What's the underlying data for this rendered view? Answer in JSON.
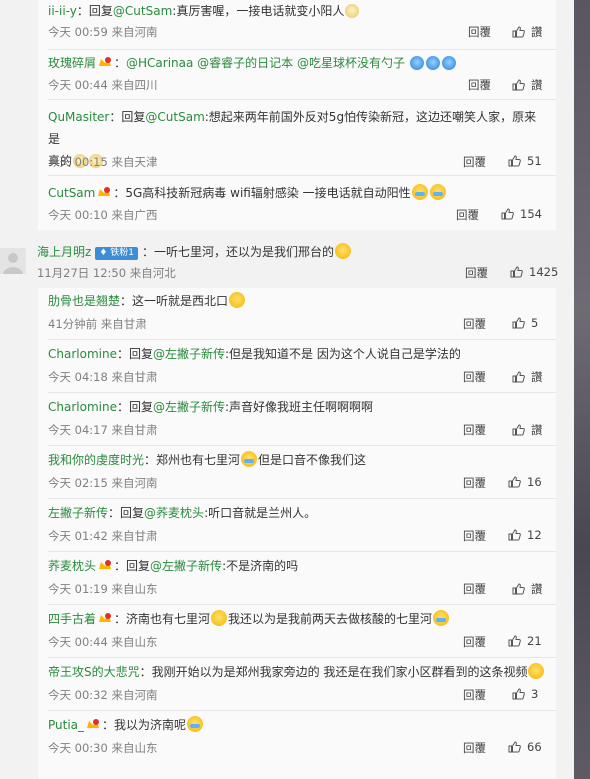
{
  "actions": {
    "reply_label": "回覆",
    "like_label": "讚"
  },
  "thread_top": [
    {
      "user": "ii-ii-y",
      "sep": "：",
      "prefix": "回复",
      "mention": "@CutSam",
      "text": ":真厉害喔，一接电话就变小阳人",
      "time": "今天 00:59 来自河南",
      "likes": "讚",
      "emoji": [
        "cat"
      ]
    },
    {
      "user": "玫瑰碎屑",
      "sep": "：",
      "prefix": "",
      "mention": "@HCarinaa @睿睿子的日记本 @吃星球杯没有勺子",
      "text": "",
      "time": "今天 00:44 来自四川",
      "likes": "讚",
      "vip": true,
      "emoji": [
        "blue",
        "blue",
        "blue"
      ]
    },
    {
      "user": "QuMasiter",
      "sep": "：",
      "prefix": "回复",
      "mention": "@CutSam",
      "text": ":想起来两年前国外反对5g怕传染新冠，这边还嘲笑人家，原来是",
      "text2": "真的",
      "time": "今天 00:15 来自天津",
      "likes": "51",
      "emoji": [
        "cat",
        "cat"
      ]
    },
    {
      "user": "CutSam",
      "sep": "：",
      "prefix": "",
      "mention": "",
      "text": "5G高科技新冠病毒 wifi辐射感染 一接电话就自动阳性",
      "time": "今天 00:10 来自广西",
      "likes": "154",
      "vip": true,
      "emoji": [
        "cry",
        "cry"
      ]
    }
  ],
  "main": {
    "user": "海上月明z",
    "badge": "铁粉1",
    "sep": "：",
    "text": "一听七里河，还以为是我们邢台的",
    "time": "11月27日 12:50 来自河北",
    "likes": "1425"
  },
  "replies": [
    {
      "user": "肋骨也是翘楚",
      "sep": "：",
      "prefix": "",
      "mention": "",
      "text": "这一听就是西北口",
      "time": "41分钟前 来自甘肃",
      "likes": "5",
      "emoji": [
        "plain"
      ]
    },
    {
      "user": "Charlomine",
      "sep": "：",
      "prefix": "回复",
      "mention": "@左撇子新传",
      "text": ":但是我知道不是 因为这个人说自己是学法的",
      "time": "今天 04:18 来自甘肃",
      "likes": "讚"
    },
    {
      "user": "Charlomine",
      "sep": "：",
      "prefix": "回复",
      "mention": "@左撇子新传",
      "text": ":声音好像我班主任啊啊啊啊",
      "time": "今天 04:17 来自甘肃",
      "likes": "讚"
    },
    {
      "user": "我和你的虔度时光",
      "sep": "：",
      "prefix": "",
      "mention": "",
      "text": "郑州也有七里河",
      "text_b": "但是口音不像我们这",
      "time": "今天 02:15 来自河南",
      "likes": "16",
      "emoji": [
        "cry"
      ]
    },
    {
      "user": "左撇子新传",
      "sep": "：",
      "prefix": "回复",
      "mention": "@荞麦枕头",
      "text": ":听口音就是兰州人。",
      "time": "今天 01:42 来自甘肃",
      "likes": "12"
    },
    {
      "user": "荞麦枕头",
      "sep": "：",
      "prefix": "回复",
      "mention": "@左撇子新传",
      "text": ":不是济南的吗",
      "time": "今天 01:19 来自山东",
      "likes": "讚",
      "vip": true
    },
    {
      "user": "四手古着",
      "sep": "：",
      "prefix": "",
      "mention": "",
      "text": "济南也有七里河",
      "text_b": "我还以为是我前两天去做核酸的七里河",
      "time": "今天 00:44 来自山东",
      "likes": "21",
      "vip": true,
      "emoji": [
        "plain",
        "cry"
      ]
    },
    {
      "user": "帝王攻S的大悲咒",
      "sep": "：",
      "prefix": "",
      "mention": "",
      "text": "我刚开始以为是郑州我家旁边的 我还是在我们家小区群看到的这条视频",
      "time": "今天 00:32 来自河南",
      "likes": "3",
      "emoji": [
        "plain"
      ]
    },
    {
      "user": "Putia_",
      "sep": "：",
      "prefix": "",
      "mention": "",
      "text": "我以为济南呢",
      "time": "今天 00:30 来自山东",
      "likes": "66",
      "vip": true,
      "emoji": [
        "cry"
      ]
    }
  ]
}
